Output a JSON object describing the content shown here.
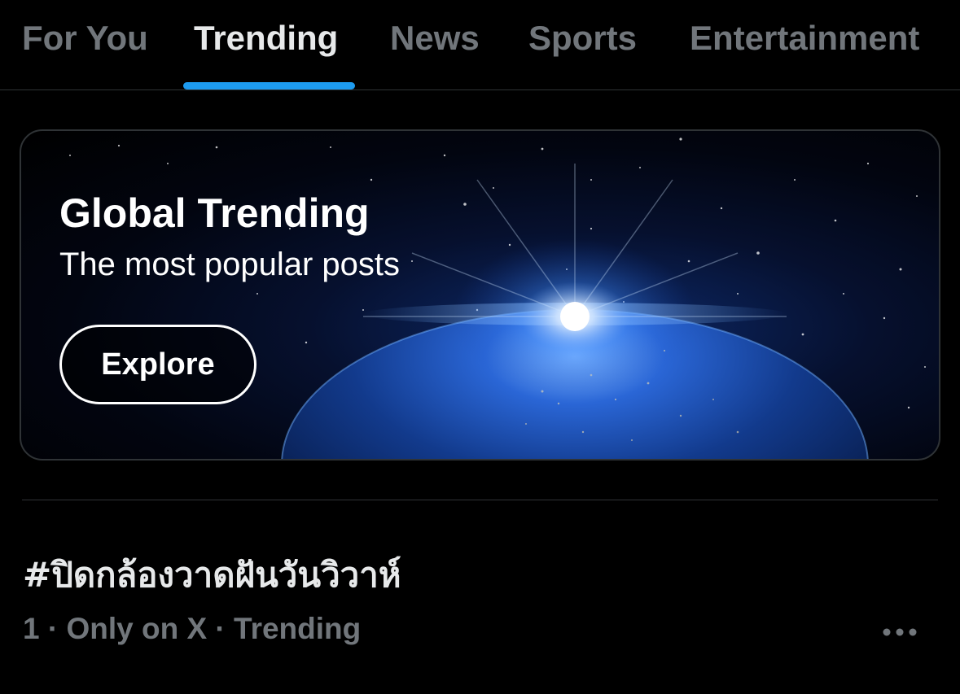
{
  "tabs": [
    {
      "label": "For You",
      "active": false
    },
    {
      "label": "Trending",
      "active": true
    },
    {
      "label": "News",
      "active": false
    },
    {
      "label": "Sports",
      "active": false
    },
    {
      "label": "Entertainment",
      "active": false
    }
  ],
  "banner": {
    "title": "Global Trending",
    "subtitle": "The most popular posts",
    "button_label": "Explore",
    "image_icon": "earth-from-space-image"
  },
  "trends": [
    {
      "name": "#ปิดกล้องวาดฝันวันวิวาห์",
      "meta": "1 · Only on X · Trending",
      "more_icon": "more-dots-icon"
    }
  ],
  "colors": {
    "background": "#000000",
    "accent": "#1d9bf0",
    "text_primary": "#e7e9ea",
    "text_secondary": "#71767b",
    "border": "#2f3336"
  }
}
